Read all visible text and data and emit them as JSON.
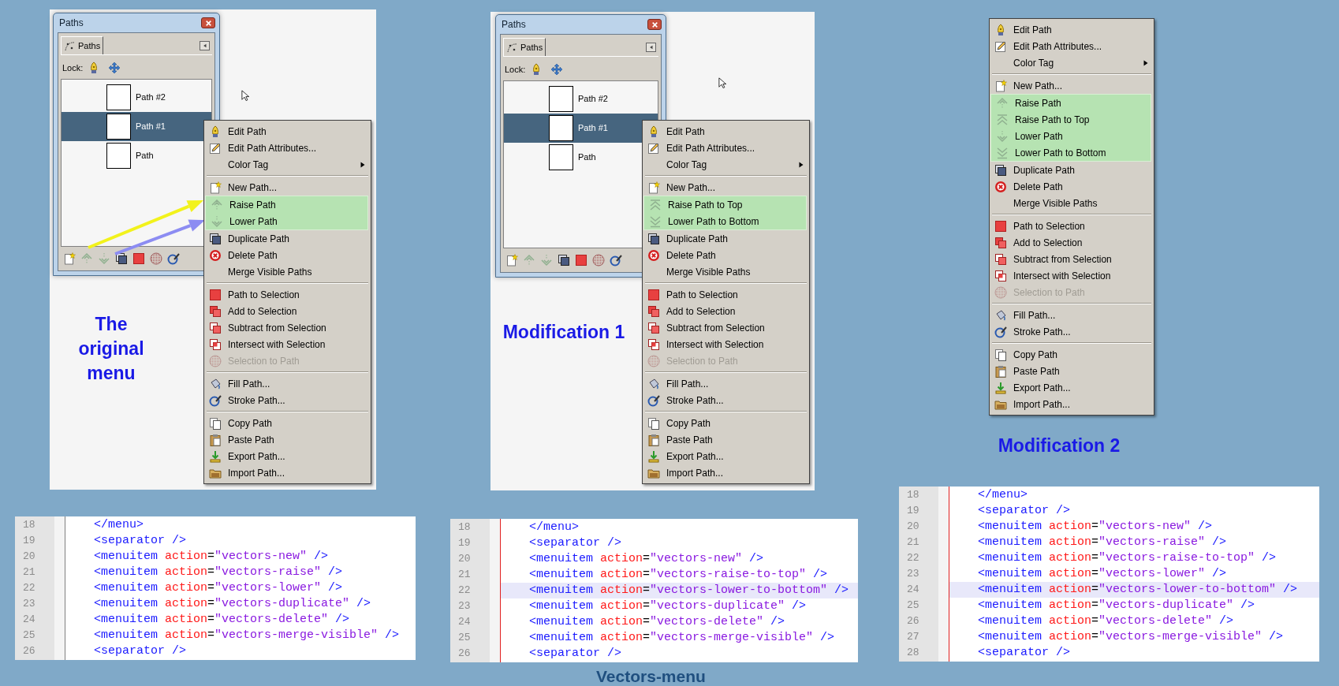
{
  "panels": [
    {
      "caption": "The original menu",
      "dialog": {
        "title": "Paths",
        "tab": "Paths",
        "lock_label": "Lock:",
        "rows": [
          {
            "name": "Path #2",
            "selected": false
          },
          {
            "name": "Path #1",
            "selected": true
          },
          {
            "name": "Path",
            "selected": false
          }
        ]
      },
      "arrows": [
        {
          "color": "#f2f21c"
        },
        {
          "color": "#8c8cf2"
        }
      ],
      "menu": [
        {
          "kind": "pen",
          "label": "Edit Path",
          "highlighted": false,
          "disabled": false
        },
        {
          "kind": "edit",
          "label": "Edit Path Attributes...",
          "highlighted": false,
          "disabled": false
        },
        {
          "kind": "submenu",
          "label": "Color Tag",
          "highlighted": false,
          "disabled": false
        },
        {
          "kind": "separator"
        },
        {
          "kind": "new",
          "label": "New Path...",
          "highlighted": false,
          "disabled": false
        },
        {
          "kind": "raise",
          "label": "Raise Path",
          "highlighted": true,
          "disabled": false
        },
        {
          "kind": "lower",
          "label": "Lower Path",
          "highlighted": true,
          "disabled": false
        },
        {
          "kind": "duplicate",
          "label": "Duplicate Path",
          "highlighted": false,
          "disabled": false
        },
        {
          "kind": "delete",
          "label": "Delete Path",
          "highlighted": false,
          "disabled": false
        },
        {
          "kind": "plain",
          "label": "Merge Visible Paths",
          "highlighted": false,
          "disabled": false
        },
        {
          "kind": "separator"
        },
        {
          "kind": "selection",
          "label": "Path to Selection",
          "highlighted": false,
          "disabled": false
        },
        {
          "kind": "add",
          "label": "Add to Selection",
          "highlighted": false,
          "disabled": false
        },
        {
          "kind": "subtract",
          "label": "Subtract from Selection",
          "highlighted": false,
          "disabled": false
        },
        {
          "kind": "intersect",
          "label": "Intersect with Selection",
          "highlighted": false,
          "disabled": false
        },
        {
          "kind": "hatched",
          "label": "Selection to Path",
          "highlighted": false,
          "disabled": true
        },
        {
          "kind": "separator"
        },
        {
          "kind": "fill",
          "label": "Fill Path...",
          "highlighted": false,
          "disabled": false
        },
        {
          "kind": "stroke",
          "label": "Stroke Path...",
          "highlighted": false,
          "disabled": false
        },
        {
          "kind": "separator"
        },
        {
          "kind": "copy",
          "label": "Copy Path",
          "highlighted": false,
          "disabled": false
        },
        {
          "kind": "paste",
          "label": "Paste Path",
          "highlighted": false,
          "disabled": false
        },
        {
          "kind": "export",
          "label": "Export Path...",
          "highlighted": false,
          "disabled": false
        },
        {
          "kind": "import",
          "label": "Import Path...",
          "highlighted": false,
          "disabled": false
        }
      ],
      "code": {
        "modified": false,
        "lines": [
          {
            "number": "18",
            "text": "</menu>",
            "highlighted": false
          },
          {
            "number": "19",
            "text": "<separator />",
            "highlighted": false
          },
          {
            "number": "20",
            "text": "<menuitem action=\"vectors-new\" />",
            "highlighted": false
          },
          {
            "number": "21",
            "text": "<menuitem action=\"vectors-raise\" />",
            "highlighted": false
          },
          {
            "number": "22",
            "text": "<menuitem action=\"vectors-lower\" />",
            "highlighted": false
          },
          {
            "number": "23",
            "text": "<menuitem action=\"vectors-duplicate\" />",
            "highlighted": false
          },
          {
            "number": "24",
            "text": "<menuitem action=\"vectors-delete\" />",
            "highlighted": false
          },
          {
            "number": "25",
            "text": "<menuitem action=\"vectors-merge-visible\" />",
            "highlighted": false
          },
          {
            "number": "26",
            "text": "<separator />",
            "highlighted": false
          }
        ]
      }
    },
    {
      "caption": "Modification 1",
      "dialog": {
        "title": "Paths",
        "tab": "Paths",
        "lock_label": "Lock:",
        "rows": [
          {
            "name": "Path #2",
            "selected": false
          },
          {
            "name": "Path #1",
            "selected": true
          },
          {
            "name": "Path",
            "selected": false
          }
        ]
      },
      "menu": [
        {
          "kind": "pen",
          "label": "Edit Path",
          "highlighted": false,
          "disabled": false
        },
        {
          "kind": "edit",
          "label": "Edit Path Attributes...",
          "highlighted": false,
          "disabled": false
        },
        {
          "kind": "submenu",
          "label": "Color Tag",
          "highlighted": false,
          "disabled": false
        },
        {
          "kind": "separator"
        },
        {
          "kind": "new",
          "label": "New Path...",
          "highlighted": false,
          "disabled": false
        },
        {
          "kind": "raise-top",
          "label": "Raise Path to Top",
          "highlighted": true,
          "disabled": false
        },
        {
          "kind": "lower-bottom",
          "label": "Lower Path to Bottom",
          "highlighted": true,
          "disabled": false
        },
        {
          "kind": "duplicate",
          "label": "Duplicate Path",
          "highlighted": false,
          "disabled": false
        },
        {
          "kind": "delete",
          "label": "Delete Path",
          "highlighted": false,
          "disabled": false
        },
        {
          "kind": "plain",
          "label": "Merge Visible Paths",
          "highlighted": false,
          "disabled": false
        },
        {
          "kind": "separator"
        },
        {
          "kind": "selection",
          "label": "Path to Selection",
          "highlighted": false,
          "disabled": false
        },
        {
          "kind": "add",
          "label": "Add to Selection",
          "highlighted": false,
          "disabled": false
        },
        {
          "kind": "subtract",
          "label": "Subtract from Selection",
          "highlighted": false,
          "disabled": false
        },
        {
          "kind": "intersect",
          "label": "Intersect with Selection",
          "highlighted": false,
          "disabled": false
        },
        {
          "kind": "hatched",
          "label": "Selection to Path",
          "highlighted": false,
          "disabled": true
        },
        {
          "kind": "separator"
        },
        {
          "kind": "fill",
          "label": "Fill Path...",
          "highlighted": false,
          "disabled": false
        },
        {
          "kind": "stroke",
          "label": "Stroke Path...",
          "highlighted": false,
          "disabled": false
        },
        {
          "kind": "separator"
        },
        {
          "kind": "copy",
          "label": "Copy Path",
          "highlighted": false,
          "disabled": false
        },
        {
          "kind": "paste",
          "label": "Paste Path",
          "highlighted": false,
          "disabled": false
        },
        {
          "kind": "export",
          "label": "Export Path...",
          "highlighted": false,
          "disabled": false
        },
        {
          "kind": "import",
          "label": "Import Path...",
          "highlighted": false,
          "disabled": false
        }
      ],
      "code": {
        "modified": true,
        "lines": [
          {
            "number": "18",
            "text": "</menu>",
            "highlighted": false
          },
          {
            "number": "19",
            "text": "<separator />",
            "highlighted": false
          },
          {
            "number": "20",
            "text": "<menuitem action=\"vectors-new\" />",
            "highlighted": false
          },
          {
            "number": "21",
            "text": "<menuitem action=\"vectors-raise-to-top\" />",
            "highlighted": false
          },
          {
            "number": "22",
            "text": "<menuitem action=\"vectors-lower-to-bottom\" />",
            "highlighted": true
          },
          {
            "number": "23",
            "text": "<menuitem action=\"vectors-duplicate\" />",
            "highlighted": false
          },
          {
            "number": "24",
            "text": "<menuitem action=\"vectors-delete\" />",
            "highlighted": false
          },
          {
            "number": "25",
            "text": "<menuitem action=\"vectors-merge-visible\" />",
            "highlighted": false
          },
          {
            "number": "26",
            "text": "<separator />",
            "highlighted": false
          }
        ]
      }
    },
    {
      "caption": "Modification 2",
      "menu": [
        {
          "kind": "pen",
          "label": "Edit Path",
          "highlighted": false,
          "disabled": false
        },
        {
          "kind": "edit",
          "label": "Edit Path Attributes...",
          "highlighted": false,
          "disabled": false
        },
        {
          "kind": "submenu",
          "label": "Color Tag",
          "highlighted": false,
          "disabled": false
        },
        {
          "kind": "separator"
        },
        {
          "kind": "new",
          "label": "New Path...",
          "highlighted": false,
          "disabled": false
        },
        {
          "kind": "raise",
          "label": "Raise Path",
          "highlighted": true,
          "disabled": false
        },
        {
          "kind": "raise-top",
          "label": "Raise Path to Top",
          "highlighted": true,
          "disabled": false
        },
        {
          "kind": "lower",
          "label": "Lower Path",
          "highlighted": true,
          "disabled": false
        },
        {
          "kind": "lower-bottom",
          "label": "Lower Path to Bottom",
          "highlighted": true,
          "disabled": false
        },
        {
          "kind": "duplicate",
          "label": "Duplicate Path",
          "highlighted": false,
          "disabled": false
        },
        {
          "kind": "delete",
          "label": "Delete Path",
          "highlighted": false,
          "disabled": false
        },
        {
          "kind": "plain",
          "label": "Merge Visible Paths",
          "highlighted": false,
          "disabled": false
        },
        {
          "kind": "separator"
        },
        {
          "kind": "selection",
          "label": "Path to Selection",
          "highlighted": false,
          "disabled": false
        },
        {
          "kind": "add",
          "label": "Add to Selection",
          "highlighted": false,
          "disabled": false
        },
        {
          "kind": "subtract",
          "label": "Subtract from Selection",
          "highlighted": false,
          "disabled": false
        },
        {
          "kind": "intersect",
          "label": "Intersect with Selection",
          "highlighted": false,
          "disabled": false
        },
        {
          "kind": "hatched",
          "label": "Selection to Path",
          "highlighted": false,
          "disabled": true
        },
        {
          "kind": "separator"
        },
        {
          "kind": "fill",
          "label": "Fill Path...",
          "highlighted": false,
          "disabled": false
        },
        {
          "kind": "stroke",
          "label": "Stroke Path...",
          "highlighted": false,
          "disabled": false
        },
        {
          "kind": "separator"
        },
        {
          "kind": "copy",
          "label": "Copy Path",
          "highlighted": false,
          "disabled": false
        },
        {
          "kind": "paste",
          "label": "Paste Path",
          "highlighted": false,
          "disabled": false
        },
        {
          "kind": "export",
          "label": "Export Path...",
          "highlighted": false,
          "disabled": false
        },
        {
          "kind": "import",
          "label": "Import Path...",
          "highlighted": false,
          "disabled": false
        }
      ],
      "code": {
        "modified": true,
        "lines": [
          {
            "number": "18",
            "text": "</menu>",
            "highlighted": false
          },
          {
            "number": "19",
            "text": "<separator />",
            "highlighted": false
          },
          {
            "number": "20",
            "text": "<menuitem action=\"vectors-new\" />",
            "highlighted": false
          },
          {
            "number": "21",
            "text": "<menuitem action=\"vectors-raise\" />",
            "highlighted": false
          },
          {
            "number": "22",
            "text": "<menuitem action=\"vectors-raise-to-top\" />",
            "highlighted": false
          },
          {
            "number": "23",
            "text": "<menuitem action=\"vectors-lower\" />",
            "highlighted": false
          },
          {
            "number": "24",
            "text": "<menuitem action=\"vectors-lower-to-bottom\" />",
            "highlighted": true
          },
          {
            "number": "25",
            "text": "<menuitem action=\"vectors-duplicate\" />",
            "highlighted": false
          },
          {
            "number": "26",
            "text": "<menuitem action=\"vectors-delete\" />",
            "highlighted": false
          },
          {
            "number": "27",
            "text": "<menuitem action=\"vectors-merge-visible\" />",
            "highlighted": false
          },
          {
            "number": "28",
            "text": "<separator />",
            "highlighted": false
          }
        ]
      }
    }
  ],
  "footer": "Vectors-menu"
}
